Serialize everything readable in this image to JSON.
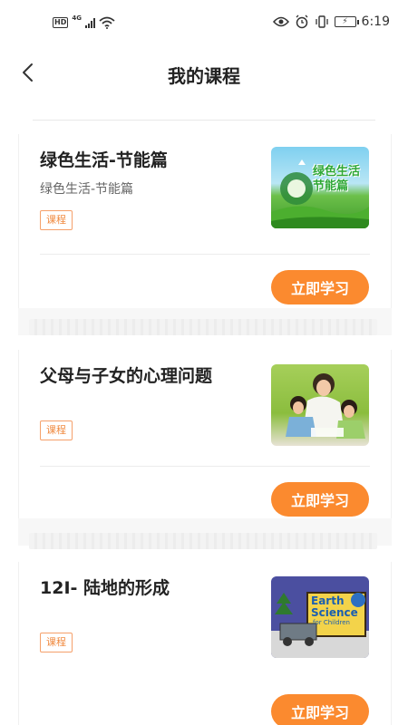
{
  "status_bar": {
    "hd": "HD",
    "network": "4G",
    "time": "6:19"
  },
  "nav": {
    "title": "我的课程"
  },
  "courses": [
    {
      "title": "绿色生活-节能篇",
      "subtitle": "绿色生活-节能篇",
      "tag": "课程",
      "button": "立即学习",
      "thumb_text": "绿色生活\n节能篇"
    },
    {
      "title": "父母与子女的心理问题",
      "subtitle": "",
      "tag": "课程",
      "button": "立即学习"
    },
    {
      "title": "12I- 陆地的形成",
      "subtitle": "",
      "tag": "课程",
      "button": "立即学习",
      "thumb_text_1": "Earth",
      "thumb_text_2": "Science",
      "thumb_text_3": "for Children"
    }
  ],
  "colors": {
    "accent": "#fb8a2f",
    "tag_border": "#f5a06a"
  }
}
